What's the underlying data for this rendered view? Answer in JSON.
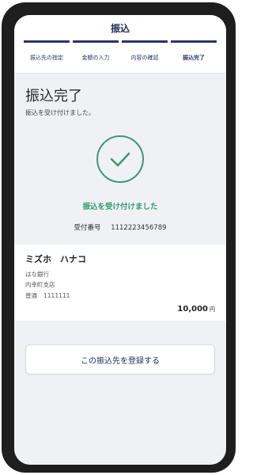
{
  "header": {
    "title": "振込"
  },
  "steps": [
    {
      "label": "振込先の指定"
    },
    {
      "label": "金額の入力"
    },
    {
      "label": "内容の確認"
    },
    {
      "label": "振込完了"
    }
  ],
  "completion": {
    "title": "振込完了",
    "subtitle": "振込を受け付けました。",
    "accepted_message": "振込を受け付けました",
    "receipt_label": "受付番号",
    "receipt_number": "1112223456789",
    "check_color": "#3a9b72"
  },
  "recipient": {
    "name": "ミズホ　ハナコ",
    "bank": "はな銀行",
    "branch": "内幸町支店",
    "account_type": "普通",
    "account_number": "1111111",
    "amount": "10,000",
    "currency": "円"
  },
  "actions": {
    "register_label": "この振込先を登録する"
  },
  "colors": {
    "accent": "#2a3566",
    "success": "#2f9b6d",
    "background": "#f0f1f5"
  }
}
